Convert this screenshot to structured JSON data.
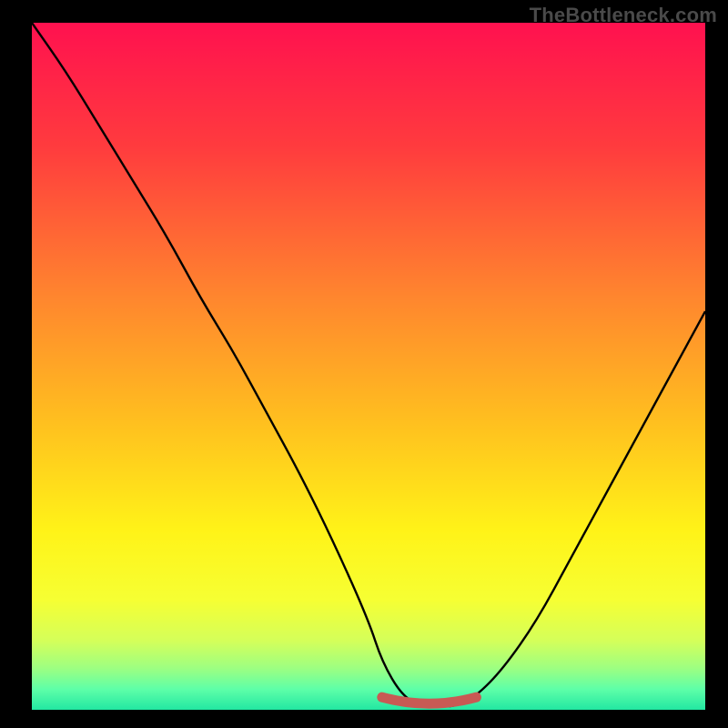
{
  "watermark": "TheBottleneck.com",
  "colors": {
    "frame": "#000000",
    "watermark": "#4a4a4a",
    "curve": "#000000",
    "valley_marker": "#c85a54",
    "gradient_stops": [
      {
        "pct": 0,
        "color": "#ff114f"
      },
      {
        "pct": 18,
        "color": "#ff3b3e"
      },
      {
        "pct": 40,
        "color": "#ff862e"
      },
      {
        "pct": 58,
        "color": "#ffbf1f"
      },
      {
        "pct": 74,
        "color": "#fff318"
      },
      {
        "pct": 84,
        "color": "#f6ff33"
      },
      {
        "pct": 90,
        "color": "#d4ff5a"
      },
      {
        "pct": 94,
        "color": "#9cff82"
      },
      {
        "pct": 97,
        "color": "#5effa8"
      },
      {
        "pct": 100,
        "color": "#22e7a2"
      }
    ]
  },
  "chart_data": {
    "type": "line",
    "title": "",
    "xlabel": "",
    "ylabel": "",
    "xlim": [
      0,
      100
    ],
    "ylim": [
      0,
      100
    ],
    "series": [
      {
        "name": "bottleneck-curve",
        "x": [
          0,
          5,
          10,
          15,
          20,
          25,
          30,
          35,
          40,
          45,
          50,
          52,
          55,
          58,
          60,
          63,
          66,
          70,
          75,
          80,
          85,
          90,
          95,
          100
        ],
        "y": [
          100,
          93,
          85,
          77,
          69,
          60,
          52,
          43,
          34,
          24,
          13,
          7,
          2,
          0.5,
          0.5,
          0.5,
          2,
          6,
          13,
          22,
          31,
          40,
          49,
          58
        ]
      }
    ],
    "valley_marker": {
      "x_start": 52,
      "x_end": 66,
      "y": 0.5
    },
    "grid": false,
    "legend": false,
    "annotations": []
  }
}
